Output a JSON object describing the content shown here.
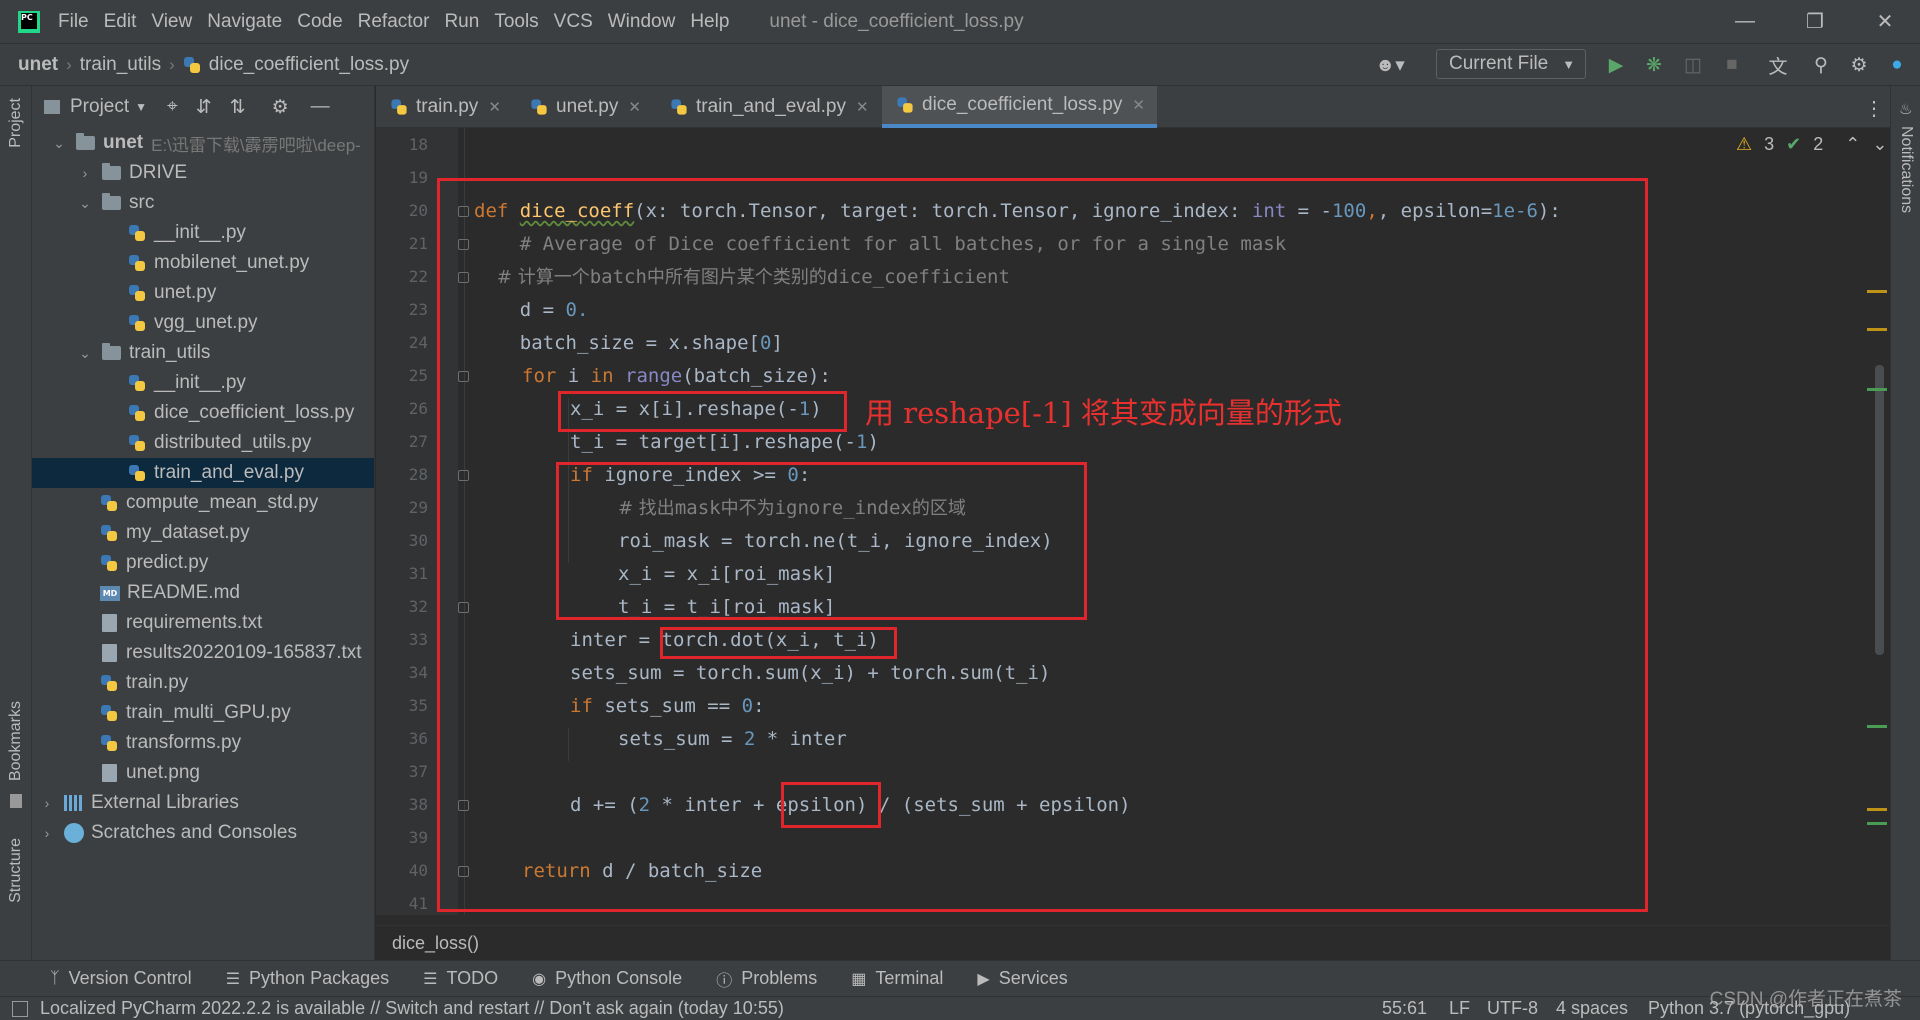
{
  "titlebar": {
    "menus": [
      "File",
      "Edit",
      "View",
      "Navigate",
      "Code",
      "Refactor",
      "Run",
      "Tools",
      "VCS",
      "Window",
      "Help"
    ],
    "window_title": "unet - dice_coefficient_loss.py",
    "minimize_icon": "minimize-icon",
    "restore_icon": "restore-icon",
    "close_icon": "close-icon"
  },
  "navbar": {
    "breadcrumb": [
      "unet",
      "train_utils",
      "dice_coefficient_loss.py"
    ],
    "run_config": "Current File"
  },
  "left_stripe": {
    "project_label": "Project",
    "bookmarks_label": "Bookmarks",
    "structure_label": "Structure"
  },
  "right_stripe": {
    "notifications_label": "Notifications"
  },
  "project": {
    "header": "Project",
    "root_name": "unet",
    "root_path": "E:\\迅雷下载\\霹雳吧啦\\deep-",
    "tree": [
      "DRIVE",
      "src",
      "__init__.py",
      "mobilenet_unet.py",
      "unet.py",
      "vgg_unet.py",
      "train_utils",
      "__init__.py",
      "dice_coefficient_loss.py",
      "distributed_utils.py",
      "train_and_eval.py",
      "compute_mean_std.py",
      "my_dataset.py",
      "predict.py",
      "README.md",
      "requirements.txt",
      "results20220109-165837.txt",
      "train.py",
      "train_multi_GPU.py",
      "transforms.py",
      "unet.png",
      "External Libraries",
      "Scratches and Consoles"
    ]
  },
  "tabs": [
    "train.py",
    "unet.py",
    "train_and_eval.py",
    "dice_coefficient_loss.py"
  ],
  "editor": {
    "line_numbers": [
      "18",
      "19",
      "20",
      "21",
      "22",
      "23",
      "24",
      "25",
      "26",
      "27",
      "28",
      "29",
      "30",
      "31",
      "32",
      "33",
      "34",
      "35",
      "36",
      "37",
      "38",
      "39",
      "40",
      "41"
    ],
    "warnings": "3",
    "weak_warnings": "2",
    "annotation": "用 reshape[-1] 将其变成向量的形式",
    "code": {
      "l20_kw": "def",
      "l20_fn": "dice_coeff",
      "l20_a": "(x: torch.Tensor, target: torch.Tensor, ignore_index: ",
      "l20_int": "int",
      "l20_b": " = -",
      "l20_100": "100",
      "l20_c": ", epsilon=",
      "l20_eps": "1e-6",
      "l20_d": "):",
      "l21": "    # Average of Dice coefficient for all batches, or for a single mask",
      "l22_a": "    # 计算一个",
      "l22_b": "batch",
      "l22_c": "中所有图片某个类别的",
      "l22_d": "dice_coefficient",
      "l23_a": "    d = ",
      "l23_num": "0.",
      "l24_a": "    batch_size = x.shape[",
      "l24_num": "0",
      "l24_b": "]",
      "l25_kw1": "for",
      "l25_a": " i ",
      "l25_kw2": "in",
      "l25_bi": "range",
      "l25_b": "(batch_size):",
      "l26_a": "x_i = x[i].reshape(-",
      "l26_num": "1",
      "l26_b": ")",
      "l27_a": "t_i = target[i].reshape(-",
      "l27_num": "1",
      "l27_b": ")",
      "l28_kw": "if",
      "l28_a": " ignore_index >= ",
      "l28_num": "0",
      "l28_b": ":",
      "l29_a": "# 找出",
      "l29_b": "mask",
      "l29_c": "中不为",
      "l29_d": "ignore_index",
      "l29_e": "的区域",
      "l30": "roi_mask = torch.ne(t_i, ignore_index)",
      "l31": "x_i = x_i[roi_mask]",
      "l32": "t_i = t_i[roi_mask]",
      "l33": "inter = torch.dot(x_i, t_i)",
      "l34": "sets_sum = torch.sum(x_i) + torch.sum(t_i)",
      "l35_kw": "if",
      "l35_a": " sets_sum == ",
      "l35_num": "0",
      "l35_b": ":",
      "l36_a": "sets_sum = ",
      "l36_num": "2",
      "l36_b": " * inter",
      "l38_a": "d += (",
      "l38_num": "2",
      "l38_b": " * inter + epsilon) / (sets_sum + epsilon)",
      "l40_kw": "return",
      "l40_a": " d / batch_size"
    },
    "bottom_breadcrumb": "dice_loss()"
  },
  "tool_windows": [
    "Version Control",
    "Python Packages",
    "TODO",
    "Python Console",
    "Problems",
    "Terminal",
    "Services"
  ],
  "statusbar": {
    "message": "Localized PyCharm 2022.2.2 is available // Switch and restart // Don't ask again (today 10:55)",
    "position": "55:61",
    "line_sep": "LF",
    "encoding": "UTF-8",
    "indent": "4 spaces",
    "interpreter": "Python 3.7 (pytorch_gpu)"
  },
  "watermark": "CSDN @作者正在煮茶",
  "colors": {
    "keyword": "#cc7832",
    "function": "#ffc66d",
    "number": "#6897bb",
    "comment": "#808080",
    "annotation_red": "#e0262c",
    "selection": "#0d293e",
    "accent": "#4a88c7"
  }
}
